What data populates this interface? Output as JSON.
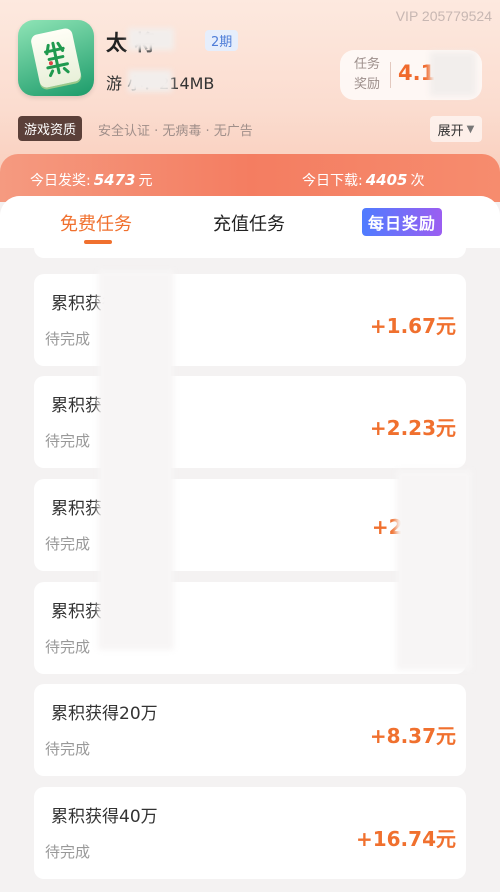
{
  "vip_id": "VIP 205779524",
  "app": {
    "title": "太 将",
    "period": "2期",
    "size_label": "游 小：214MB"
  },
  "reward": {
    "label": "任务\n奖励",
    "label_line1": "任务",
    "label_line2": "奖励",
    "amount": "4.1"
  },
  "qualification": {
    "tag": "游戏资质",
    "text": "安全认证 · 无病毒 · 无广告",
    "expand": "展开"
  },
  "stats": {
    "today_paid_label": "今日发奖:",
    "today_paid_value": "5473",
    "today_paid_unit": "元",
    "today_download_label": "今日下载:",
    "today_download_value": "4405",
    "today_download_unit": "次"
  },
  "tabs": {
    "free": "免费任务",
    "recharge": "充值任务",
    "daily": "每日奖励"
  },
  "tasks": [
    {
      "title": "累积获得1",
      "status": "待完成",
      "reward": "+1.67元"
    },
    {
      "title": "累积获 万",
      "status": "待完成",
      "reward": "+2.23元"
    },
    {
      "title": "累积获 万",
      "status": "待完成",
      "reward": "+2.79"
    },
    {
      "title": "累积获 0万",
      "status": "待完成",
      "reward": "元"
    },
    {
      "title": "累积获得20万",
      "status": "待完成",
      "reward": "+8.37元"
    },
    {
      "title": "累积获得40万",
      "status": "待完成",
      "reward": "+16.74元"
    }
  ],
  "colors": {
    "accent": "#f0702e",
    "stats_bar": "#f47d61",
    "badge_text": "#4f7dd8"
  },
  "icons": {
    "app_icon": "mahjong-tile-icon",
    "expand_arrow": "triangle-down-icon"
  }
}
